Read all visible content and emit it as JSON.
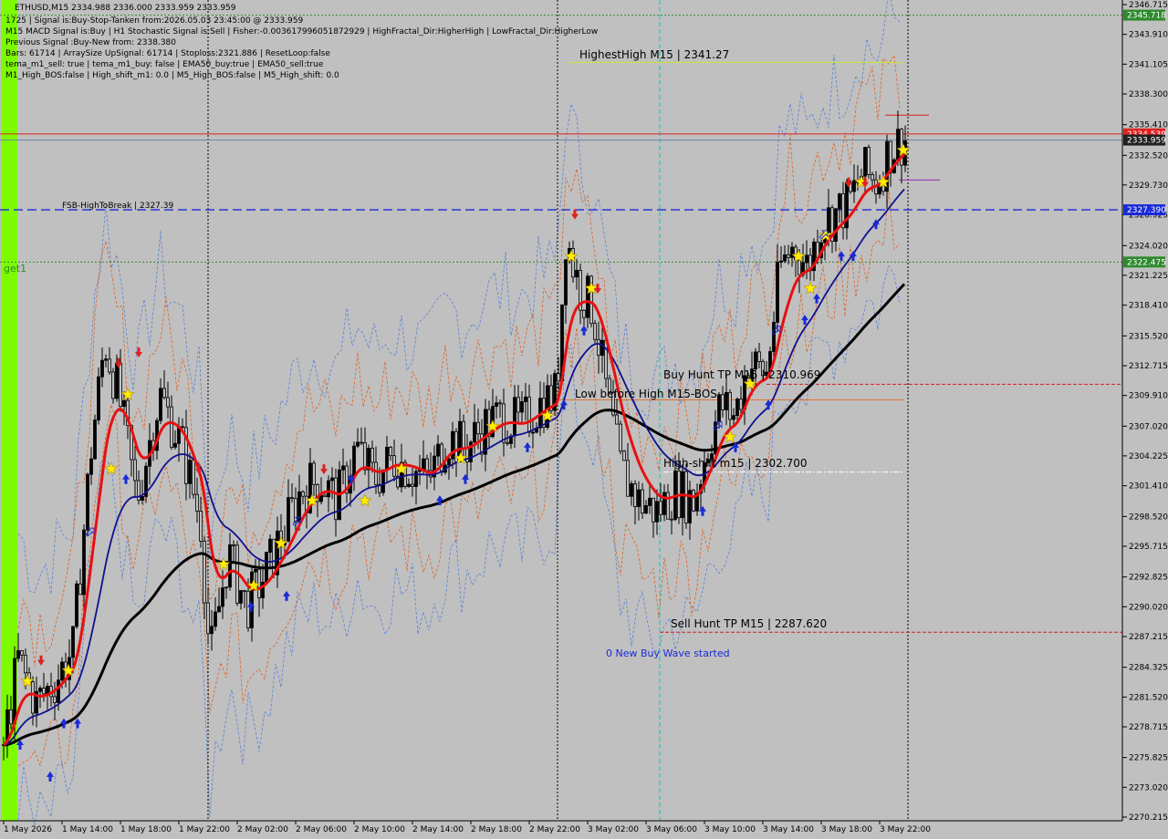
{
  "header": {
    "symbol": "ETHUSD,M15",
    "ohlc": "2334.988 2336.000 2333.959 2333.959"
  },
  "info_lines": [
    "1725 | Signal is:Buy-Stop-Tanken from:2026.05.03 23:45:00 @ 2333.959",
    "M15 MACD Signal is:Buy | H1 Stochastic Signal is:Sell | Fisher:-0.003617996051872929 | HighFractal_Dir:HigherHigh | LowFractal_Dir:HigherLow",
    "Previous Signal :Buy-New from: 2338.380",
    "Bars: 61714 | ArraySize UpSignal: 61714 | Stoploss:2321.886 | ResetLoop:false",
    "tema_m1_sell: true | tema_m1_buy: false | EMA50_buy:true | EMA50_sell:true",
    "M1_High_BOS:false | High_shift_m1: 0.0 | M5_High_BOS:false | M5_High_shift: 0.0"
  ],
  "price_axis": {
    "ticks": [
      "2346.715",
      "2343.910",
      "2341.105",
      "2338.300",
      "2335.410",
      "2332.520",
      "2329.730",
      "2326.925",
      "2324.020",
      "2321.225",
      "2318.410",
      "2315.520",
      "2312.715",
      "2309.910",
      "2307.020",
      "2304.225",
      "2301.410",
      "2298.520",
      "2295.715",
      "2292.825",
      "2290.020",
      "2287.215",
      "2284.325",
      "2281.520",
      "2278.715",
      "2275.825",
      "2273.020",
      "2270.215"
    ],
    "ymin": 2270.215,
    "ymax": 2346.715
  },
  "price_tags": [
    {
      "value": 2345.718,
      "text": "2345.718",
      "color": "#2e8b2e"
    },
    {
      "value": 2334.539,
      "text": "2334.539",
      "color": "#e02020"
    },
    {
      "value": 2333.959,
      "text": "2333.959",
      "color": "#202020"
    },
    {
      "value": 2327.39,
      "text": "2327.390",
      "color": "#1a2ad8"
    },
    {
      "value": 2322.475,
      "text": "2322.475",
      "color": "#2e8b2e"
    }
  ],
  "time_axis": {
    "labels": [
      "1 May 2026",
      "1 May 14:00",
      "1 May 18:00",
      "1 May 22:00",
      "2 May 02:00",
      "2 May 06:00",
      "2 May 10:00",
      "2 May 14:00",
      "2 May 18:00",
      "2 May 22:00",
      "3 May 02:00",
      "3 May 06:00",
      "3 May 10:00",
      "3 May 14:00",
      "3 May 18:00",
      "3 May 22:00"
    ]
  },
  "level_labels": {
    "highest_high": "HighestHigh   M15 | 2341.27",
    "fsb": "FSB-HighToBreak | 2327.39",
    "buy_hunt": "Buy Hunt  TP M15 | 2310.969",
    "low_before_high": "Low before High   M15-BOS",
    "high_shift": "High-shift m15 | 2302.700",
    "sell_hunt": "Sell Hunt TP M15 | 2287.620",
    "wave": "0 New Buy Wave started",
    "target": "get1"
  },
  "levels": {
    "highest_high": 2341.27,
    "fsb": 2327.39,
    "buy_hunt": 2310.969,
    "low_before_high": 2309.5,
    "high_shift": 2302.7,
    "sell_hunt": 2287.62
  },
  "colors": {
    "background": "#c0c0c0",
    "bull_candle": "#000000",
    "ema_fast": "#e81010",
    "ema_mid": "#101090",
    "ema_slow": "#000000",
    "green_bar": "#7cfc00"
  },
  "chart_data": {
    "type": "candlestick",
    "title": "ETHUSD,M15",
    "ylim": [
      2270.215,
      2346.715
    ],
    "series": [
      {
        "name": "price",
        "anchors": [
          [
            0,
            2275
          ],
          [
            20,
            2285
          ],
          [
            40,
            2281
          ],
          [
            60,
            2283
          ],
          [
            80,
            2286
          ],
          [
            100,
            2305
          ],
          [
            115,
            2315
          ],
          [
            130,
            2310
          ],
          [
            150,
            2300
          ],
          [
            175,
            2310
          ],
          [
            200,
            2305
          ],
          [
            220,
            2298
          ],
          [
            230,
            2285
          ],
          [
            250,
            2295
          ],
          [
            270,
            2290
          ],
          [
            290,
            2293
          ],
          [
            310,
            2297
          ],
          [
            330,
            2301
          ],
          [
            350,
            2302
          ],
          [
            370,
            2300
          ],
          [
            390,
            2305
          ],
          [
            410,
            2302
          ],
          [
            430,
            2304
          ],
          [
            450,
            2303
          ],
          [
            470,
            2302
          ],
          [
            490,
            2306
          ],
          [
            510,
            2305
          ],
          [
            530,
            2307
          ],
          [
            550,
            2308
          ],
          [
            570,
            2307
          ],
          [
            590,
            2309
          ],
          [
            610,
            2310
          ],
          [
            620,
            2325
          ],
          [
            635,
            2320
          ],
          [
            650,
            2318
          ],
          [
            665,
            2310
          ],
          [
            680,
            2303
          ],
          [
            700,
            2300
          ],
          [
            720,
            2299
          ],
          [
            740,
            2301
          ],
          [
            760,
            2300
          ],
          [
            775,
            2305
          ],
          [
            790,
            2309
          ],
          [
            805,
            2308
          ],
          [
            820,
            2313
          ],
          [
            840,
            2312
          ],
          [
            855,
            2322
          ],
          [
            870,
            2324
          ],
          [
            885,
            2322
          ],
          [
            900,
            2326
          ],
          [
            915,
            2327
          ],
          [
            930,
            2328
          ],
          [
            945,
            2331
          ],
          [
            960,
            2330
          ],
          [
            975,
            2333
          ],
          [
            990,
            2334
          ]
        ]
      }
    ]
  }
}
